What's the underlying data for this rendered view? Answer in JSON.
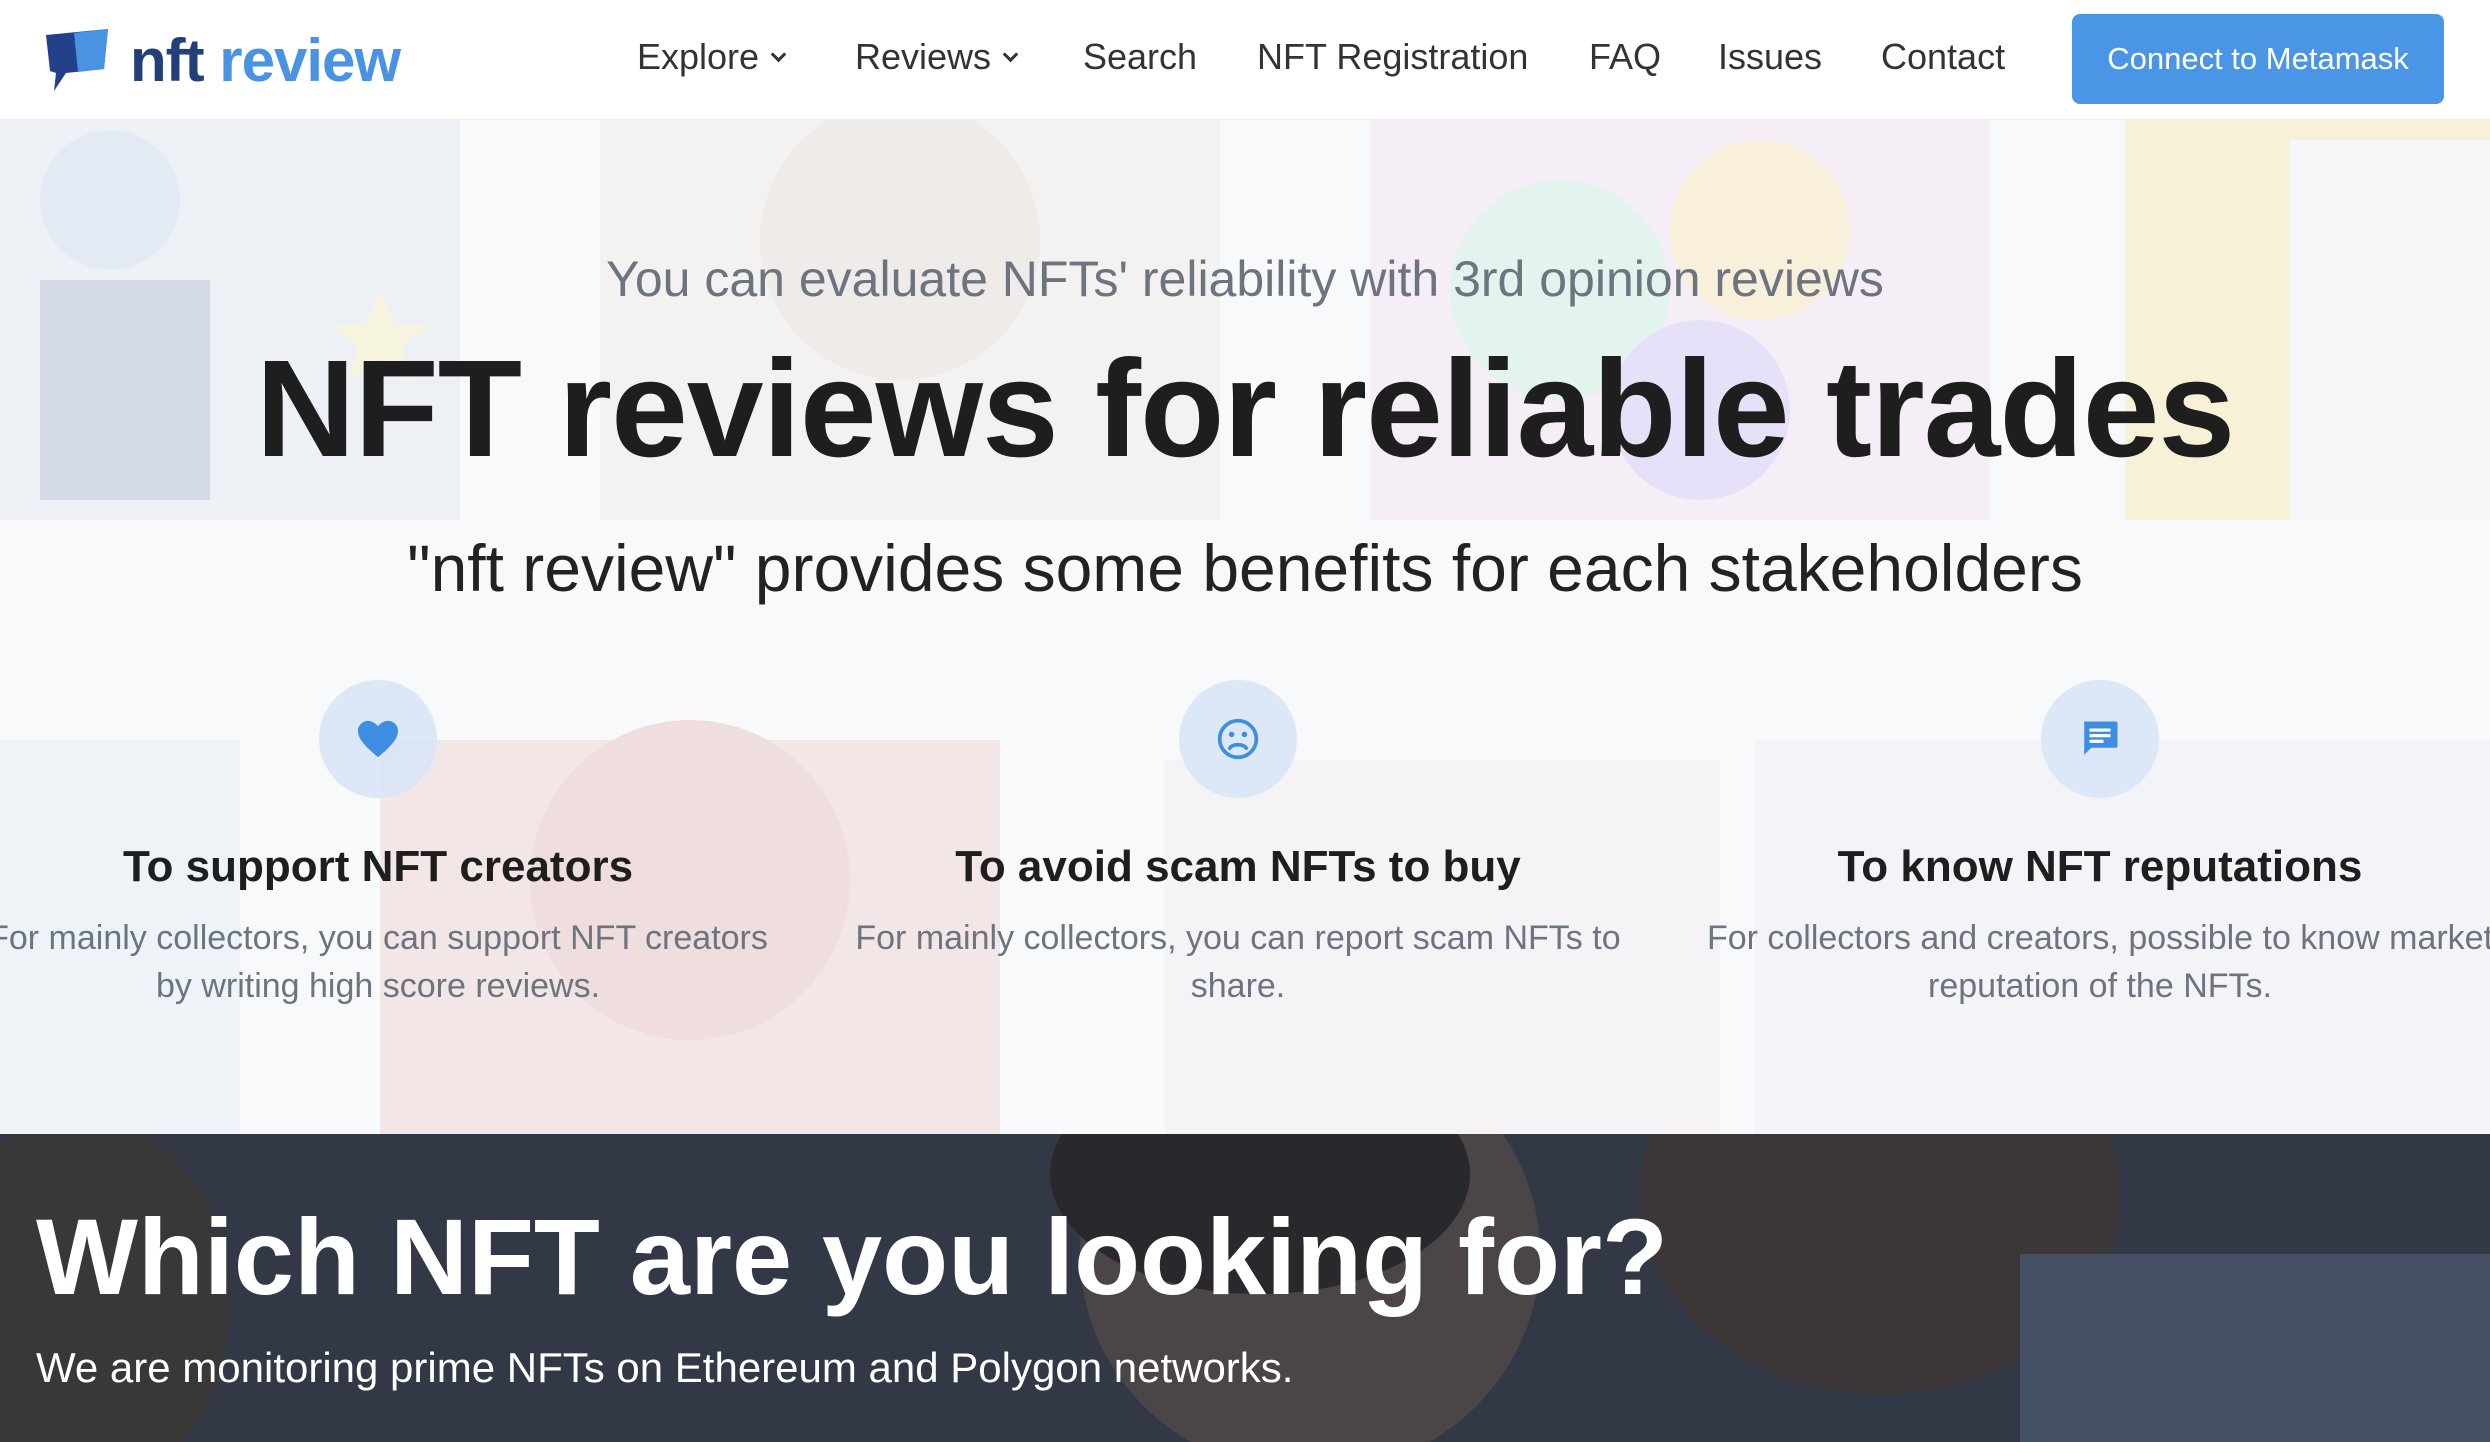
{
  "brand": {
    "name_part1": "nft",
    "name_part2": "review"
  },
  "nav": {
    "items": [
      {
        "label": "Explore",
        "dropdown": true
      },
      {
        "label": "Reviews",
        "dropdown": true
      },
      {
        "label": "Search",
        "dropdown": false
      },
      {
        "label": "NFT Registration",
        "dropdown": false
      },
      {
        "label": "FAQ",
        "dropdown": false
      },
      {
        "label": "Issues",
        "dropdown": false
      },
      {
        "label": "Contact",
        "dropdown": false
      }
    ],
    "connect_label": "Connect to Metamask"
  },
  "hero": {
    "subtitle": "You can evaluate NFTs' reliability with 3rd opinion reviews",
    "title": "NFT reviews for reliable trades",
    "lead": "\"nft review\" provides some benefits for each stakeholders"
  },
  "features": [
    {
      "icon": "heart-icon",
      "title": "To support NFT creators",
      "desc": "For mainly collectors, you can support NFT creators by writing high score reviews."
    },
    {
      "icon": "sad-face-icon",
      "title": "To avoid scam NFTs to buy",
      "desc": "For mainly collectors, you can report scam NFTs to share."
    },
    {
      "icon": "message-icon",
      "title": "To know NFT reputations",
      "desc": "For collectors and creators, possible to know market reputation of the NFTs."
    }
  ],
  "banner": {
    "title": "Which NFT are you looking for?",
    "desc": "We are monitoring prime NFTs on Ethereum and Polygon networks."
  },
  "colors": {
    "accent": "#4a95e6",
    "brand_dark": "#233f7a",
    "text_muted": "#6c7480"
  }
}
